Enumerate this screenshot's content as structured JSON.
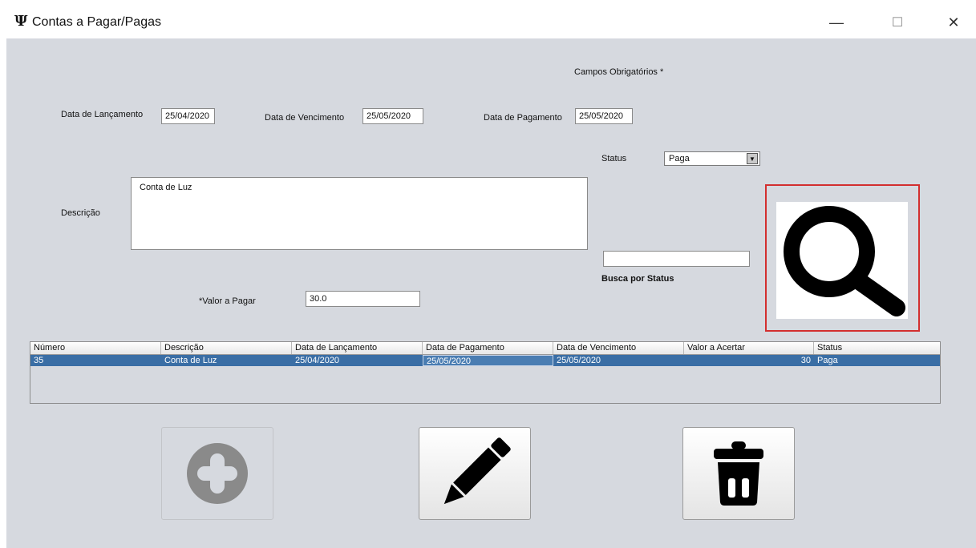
{
  "window": {
    "app_icon": "Ψ",
    "title": "Contas a Pagar/Pagas",
    "controls": {
      "minimize": "—",
      "maximize": "☐",
      "close": "✕"
    }
  },
  "form": {
    "required_note": "Campos Obrigatórios *",
    "launch_date_label": "Data de Lançamento",
    "launch_date_value": "25/04/2020",
    "due_date_label": "Data de Vencimento",
    "due_date_value": "25/05/2020",
    "payment_date_label": "Data de Pagamento",
    "payment_date_value": "25/05/2020",
    "status_label": "Status",
    "status_value": "Paga",
    "description_label": "Descrição",
    "description_value": "Conta de Luz",
    "amount_label": "*Valor a Pagar",
    "amount_value": "30.0",
    "status_search_value": "",
    "status_search_label": "Busca por Status"
  },
  "table": {
    "columns": [
      "Número",
      "Descrição",
      "Data de Lançamento",
      "Data de Pagamento",
      "Data de Vencimento",
      "Valor a Acertar",
      "Status"
    ],
    "rows": [
      [
        "35",
        "Conta de Luz",
        "25/04/2020",
        "25/05/2020",
        "25/05/2020",
        "30",
        "Paga"
      ]
    ]
  },
  "icons": {
    "search": "search-icon",
    "add": "add-icon",
    "edit": "pencil-icon",
    "delete": "trash-icon"
  },
  "colors": {
    "window_bg": "#d6d9df",
    "selection": "#3a6ea5",
    "highlight_border": "#d32f2f"
  }
}
